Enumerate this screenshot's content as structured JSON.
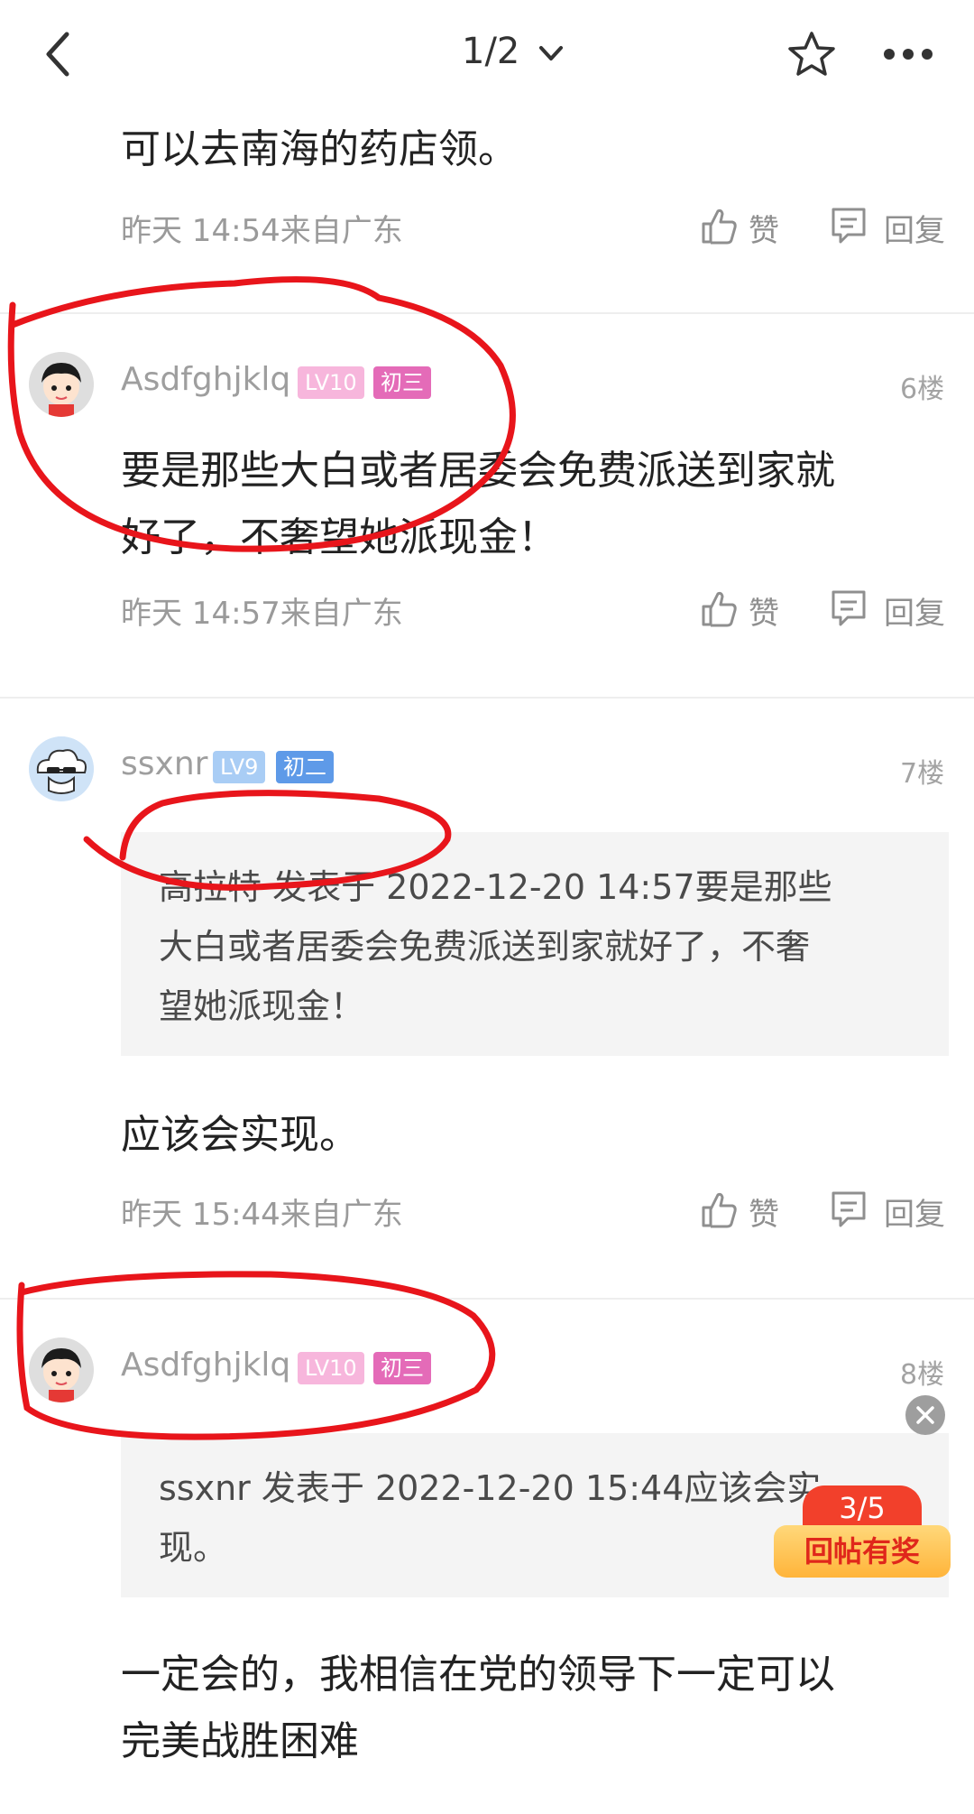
{
  "top_bar": {
    "page_indicator": "1/2"
  },
  "posts": [
    {
      "text": "可以去南海的药店领。",
      "meta": "昨天 14:54来自广东",
      "like_label": "赞",
      "reply_label": "回复"
    },
    {
      "username": "Asdfghjklq",
      "level": "LV10",
      "grade": "初三",
      "floor": "6楼",
      "text_lines": [
        "要是那些大白或者居委会免费派送到家就",
        "好了，不奢望她派现金！"
      ],
      "meta": "昨天 14:57来自广东",
      "like_label": "赞",
      "reply_label": "回复"
    },
    {
      "username": "ssxnr",
      "level": "LV9",
      "grade": "初二",
      "floor": "7楼",
      "quote_lines": [
        "高拉特 发表于 2022-12-20 14:57要是那些",
        "大白或者居委会免费派送到家就好了，不奢",
        "望她派现金！"
      ],
      "text": "应该会实现。",
      "meta": "昨天 15:44来自广东",
      "like_label": "赞",
      "reply_label": "回复"
    },
    {
      "username": "Asdfghjklq",
      "level": "LV10",
      "grade": "初三",
      "floor": "8楼",
      "quote_lines": [
        "ssxnr 发表于 2022-12-20 15:44应该会实",
        "现。"
      ],
      "text_lines": [
        "一定会的，我相信在党的领导下一定可以",
        "完美战胜困难"
      ]
    }
  ],
  "reward": {
    "count": "3/5",
    "label": "回帖有奖"
  },
  "colors": {
    "accent_pink": "#f7b6dc",
    "accent_blue": "#a9cdf5",
    "annotation_red": "#e8151b"
  }
}
